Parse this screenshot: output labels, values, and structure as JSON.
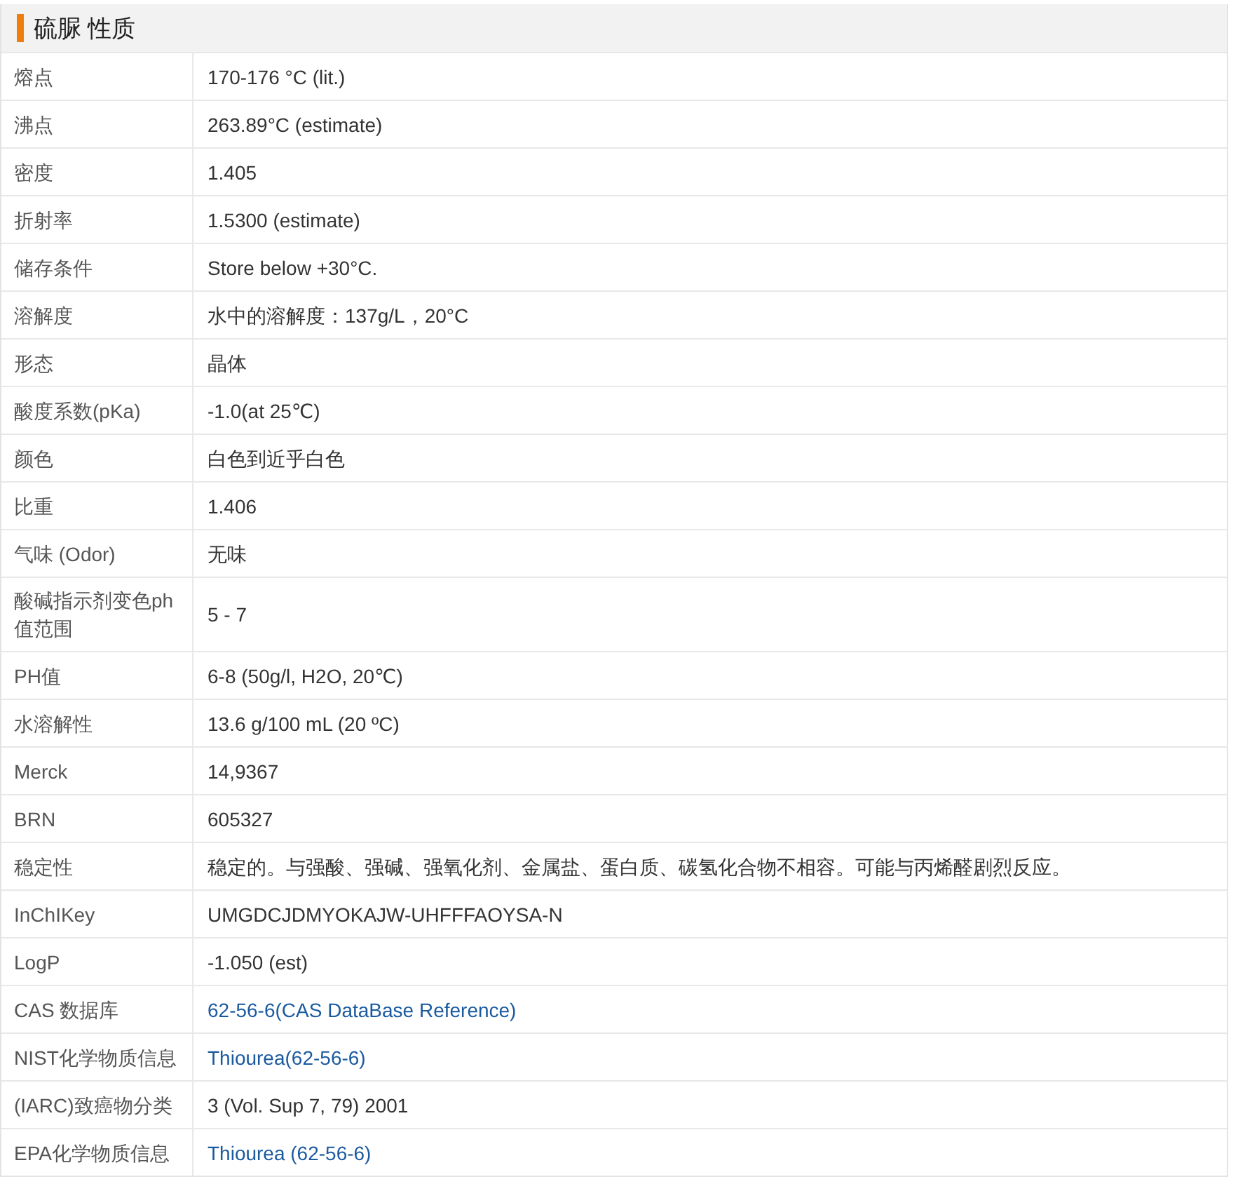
{
  "title": "硫脲 性质",
  "rows": [
    {
      "label": "熔点",
      "value": "170-176 °C (lit.)",
      "kind": "text"
    },
    {
      "label": "沸点",
      "value": "263.89°C (estimate)",
      "kind": "text"
    },
    {
      "label": "密度",
      "value": "1.405",
      "kind": "text"
    },
    {
      "label": "折射率",
      "value": "1.5300 (estimate)",
      "kind": "text"
    },
    {
      "label": "储存条件",
      "value": "Store below +30°C.",
      "kind": "text"
    },
    {
      "label": "溶解度",
      "value": "水中的溶解度：137g/L，20°C",
      "kind": "text"
    },
    {
      "label": "形态",
      "value": "晶体",
      "kind": "text"
    },
    {
      "label": "酸度系数(pKa)",
      "value": "-1.0(at 25℃)",
      "kind": "text"
    },
    {
      "label": "颜色",
      "value": "白色到近乎白色",
      "kind": "text"
    },
    {
      "label": "比重",
      "value": "1.406",
      "kind": "text"
    },
    {
      "label": "气味 (Odor)",
      "value": "无味",
      "kind": "text"
    },
    {
      "label": "酸碱指示剂变色ph值范围",
      "value": "5 - 7",
      "kind": "text"
    },
    {
      "label": "PH值",
      "value": "6-8 (50g/l, H2O, 20℃)",
      "kind": "text"
    },
    {
      "label": "水溶解性",
      "value": "13.6 g/100 mL (20 ºC)",
      "kind": "text"
    },
    {
      "label": "Merck",
      "value": "14,9367",
      "kind": "text"
    },
    {
      "label": "BRN",
      "value": "605327",
      "kind": "text"
    },
    {
      "label": "稳定性",
      "value": "稳定的。与强酸、强碱、强氧化剂、金属盐、蛋白质、碳氢化合物不相容。可能与丙烯醛剧烈反应。",
      "kind": "text"
    },
    {
      "label": "InChIKey",
      "value": "UMGDCJDMYOKAJW-UHFFFAOYSA-N",
      "kind": "text"
    },
    {
      "label": "LogP",
      "value": "-1.050 (est)",
      "kind": "text"
    },
    {
      "label": "CAS 数据库",
      "value": "62-56-6(CAS DataBase Reference)",
      "kind": "link"
    },
    {
      "label": "NIST化学物质信息",
      "value": "Thiourea(62-56-6)",
      "kind": "link"
    },
    {
      "label": "(IARC)致癌物分类",
      "value": "3 (Vol. Sup 7, 79) 2001",
      "kind": "text"
    },
    {
      "label": "EPA化学物质信息",
      "value": "Thiourea (62-56-6)",
      "kind": "link"
    }
  ]
}
